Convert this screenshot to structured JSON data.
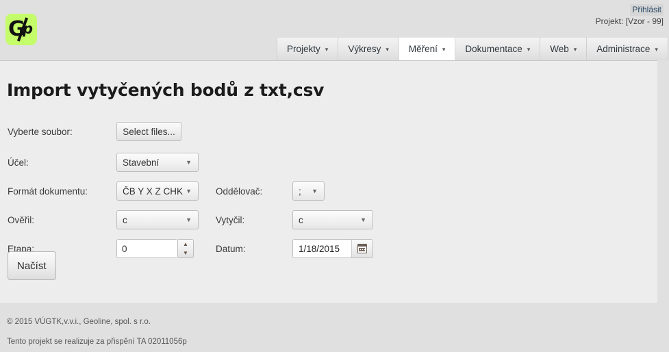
{
  "header": {
    "logo_letter": "G",
    "logo_mark": "p",
    "login_label": "Přihlásit",
    "project_label": "Projekt: [Vzor - 99]",
    "nav": [
      {
        "label": "Projekty",
        "caret": "▾",
        "active": false
      },
      {
        "label": "Výkresy",
        "caret": "▾",
        "active": false
      },
      {
        "label": "Měření",
        "caret": "▾",
        "active": true
      },
      {
        "label": "Dokumentace",
        "caret": "▾",
        "active": false
      },
      {
        "label": "Web",
        "caret": "▾",
        "active": false
      },
      {
        "label": "Administrace",
        "caret": "▾",
        "active": false
      }
    ]
  },
  "page": {
    "title": "Import vytyčených bodů z txt,csv"
  },
  "form": {
    "file_label": "Vyberte soubor:",
    "file_button": "Select files...",
    "purpose_label": "Účel:",
    "purpose_value": "Stavební",
    "format_label": "Formát dokumentu:",
    "format_value": "ČB Y X Z CHK",
    "separator_label": "Oddělovač:",
    "separator_value": ";",
    "verified_label": "Ověřil:",
    "verified_value": "c",
    "surveyed_label": "Vytyčil:",
    "surveyed_value": "c",
    "stage_label": "Etapa:",
    "stage_value": "0",
    "spin_up": "▲",
    "spin_down": "▼",
    "date_label": "Datum:",
    "date_value": "1/18/2015",
    "submit_label": "Načíst",
    "dropdown_arrow": "▼"
  },
  "footer": {
    "copyright": "© 2015 VÚGTK,v.v.i., Geoline, spol. s r.o.",
    "grant": "Tento projekt se realizuje za přispění TA 02011056p"
  },
  "colors": {
    "logo_green": "#c4fc6a",
    "page_bg": "#e0e0e0",
    "panel_bg": "#ededed",
    "link": "#2b4a66"
  }
}
